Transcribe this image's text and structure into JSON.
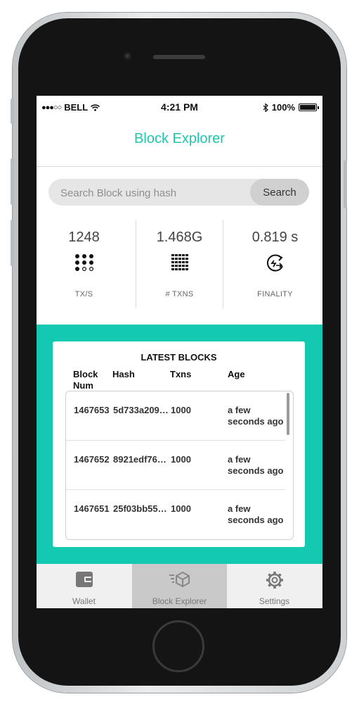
{
  "status_bar": {
    "carrier_signal": "●●●○○",
    "carrier": "BELL",
    "time": "4:21 PM",
    "battery": "100%"
  },
  "header": {
    "title": "Block Explorer"
  },
  "search": {
    "placeholder": "Search Block using hash",
    "button_label": "Search"
  },
  "stats": [
    {
      "value": "1248",
      "label": "TX/S",
      "icon": "dots-grid-icon"
    },
    {
      "value": "1.468G",
      "label": "# TXNS",
      "icon": "dense-grid-icon"
    },
    {
      "value": "0.819 s",
      "label": "FINALITY",
      "icon": "cycle-timer-icon"
    }
  ],
  "latest_blocks": {
    "title": "LATEST BLOCKS",
    "columns": [
      "Block Num",
      "Hash",
      "Txns",
      "Age"
    ],
    "rows": [
      {
        "num": "1467653",
        "hash": "5d733a209…",
        "txns": "1000",
        "age": "a few seconds ago"
      },
      {
        "num": "1467652",
        "hash": "8921edf76…",
        "txns": "1000",
        "age": "a few seconds ago"
      },
      {
        "num": "1467651",
        "hash": "25f03bb55…",
        "txns": "1000",
        "age": "a few seconds ago"
      }
    ]
  },
  "tabs": [
    {
      "label": "Wallet",
      "icon": "wallet-icon",
      "active": false
    },
    {
      "label": "Block Explorer",
      "icon": "block-explorer-icon",
      "active": true
    },
    {
      "label": "Settings",
      "icon": "gear-icon",
      "active": false
    }
  ],
  "colors": {
    "accent": "#14c9b1",
    "title": "#1ec8ae",
    "tab_active_bg": "#c9c9c9"
  }
}
